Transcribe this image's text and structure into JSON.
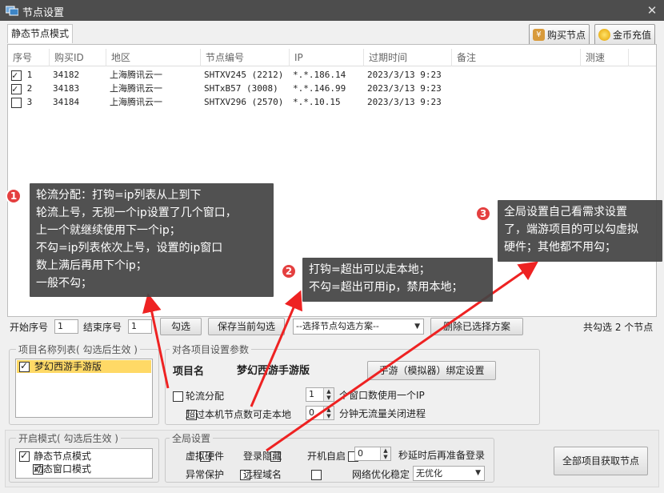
{
  "window": {
    "title": "节点设置",
    "close": "✕"
  },
  "tabs": [
    {
      "label": "静态节点模式"
    }
  ],
  "top_buttons": {
    "buy": "购买节点",
    "recharge": "金币充值"
  },
  "table": {
    "columns": [
      "序号",
      "购买ID",
      "地区",
      "节点编号",
      "IP",
      "过期时间",
      "备注",
      "测速"
    ],
    "rows": [
      {
        "checked": true,
        "no": "1",
        "buy_id": "34182",
        "region": "上海腾讯云一",
        "node": "SHTXV245 (2212)",
        "ip": "*.*.186.14",
        "expire": "2023/3/13 9:23",
        "note": "",
        "speed": ""
      },
      {
        "checked": true,
        "no": "2",
        "buy_id": "34183",
        "region": "上海腾讯云一",
        "node": "SHTxB57 (3008)",
        "ip": "*.*.146.99",
        "expire": "2023/3/13 9:23",
        "note": "",
        "speed": ""
      },
      {
        "checked": false,
        "no": "3",
        "buy_id": "34184",
        "region": "上海腾讯云一",
        "node": "SHTXV296 (2570)",
        "ip": "*.*.10.15",
        "expire": "2023/3/13 9:23",
        "note": "",
        "speed": ""
      }
    ]
  },
  "callouts": {
    "c1": {
      "num": "1",
      "lines": [
        "轮流分配：打钩=ip列表从上到下",
        "轮流上号，无视一个ip设置了几个窗口，",
        "上一个就继续使用下一个ip；",
        "不勾=ip列表依次上号，设置的ip窗口",
        "数上满后再用下个ip；",
        "一般不勾；"
      ]
    },
    "c2": {
      "num": "2",
      "lines": [
        "打钩=超出可以走本地；",
        "不勾=超出可用ip，禁用本地；"
      ]
    },
    "c3": {
      "num": "3",
      "lines": [
        "全局设置自己看需求设置",
        "了，端游项目的可以勾虚拟",
        "硬件；其他都不用勾；"
      ]
    }
  },
  "toolbar": {
    "start_label": "开始序号",
    "start_value": "1",
    "end_label": "结束序号",
    "end_value": "1",
    "check_btn": "勾选",
    "save_btn": "保存当前勾选",
    "scheme_select": "--选择节点勾选方案--",
    "delete_btn": "删除已选择方案",
    "total": "共勾选 2 个节点"
  },
  "project_list": {
    "title": "项目名称列表( 勾选后生效 )",
    "items": [
      {
        "label": "梦幻西游手游版",
        "checked": true
      }
    ]
  },
  "project_params": {
    "title": "对各项目设置参数",
    "name_label": "项目名",
    "name_value": "梦幻西游手游版",
    "bind_btn": "手游（模拟器）绑定设置",
    "round_robin": "轮流分配",
    "round_robin_checked": false,
    "windows_value": "1",
    "windows_label": "个窗口数使用一个IP",
    "exceed_local": "超过本机节点数可走本地",
    "exceed_local_checked": false,
    "minutes_value": "0",
    "minutes_label": "分钟无流量关闭进程"
  },
  "modes": {
    "title": "开启模式( 勾选后生效 )",
    "items": [
      {
        "label": "静态节点模式",
        "checked": true
      },
      {
        "label": "动态窗口模式",
        "checked": true
      }
    ]
  },
  "global": {
    "title": "全局设置",
    "virtual_hw": "虚拟硬件",
    "hide_login": "登录隐藏",
    "autostart": "开机自启",
    "delay_value": "0",
    "delay_label": "秒延时后再准备登录",
    "exception_protect": "异常保护",
    "remote_domain": "远程域名",
    "net_opt_label": "网络优化稳定",
    "net_opt_value": "无优化"
  },
  "fetch_btn": "全部项目获取节点",
  "colors": {
    "titlebar": "#4d4d4d",
    "callout": "#444444",
    "badge": "#e43f3f",
    "arrow": "#ee2222",
    "selection": "#ffd966"
  }
}
